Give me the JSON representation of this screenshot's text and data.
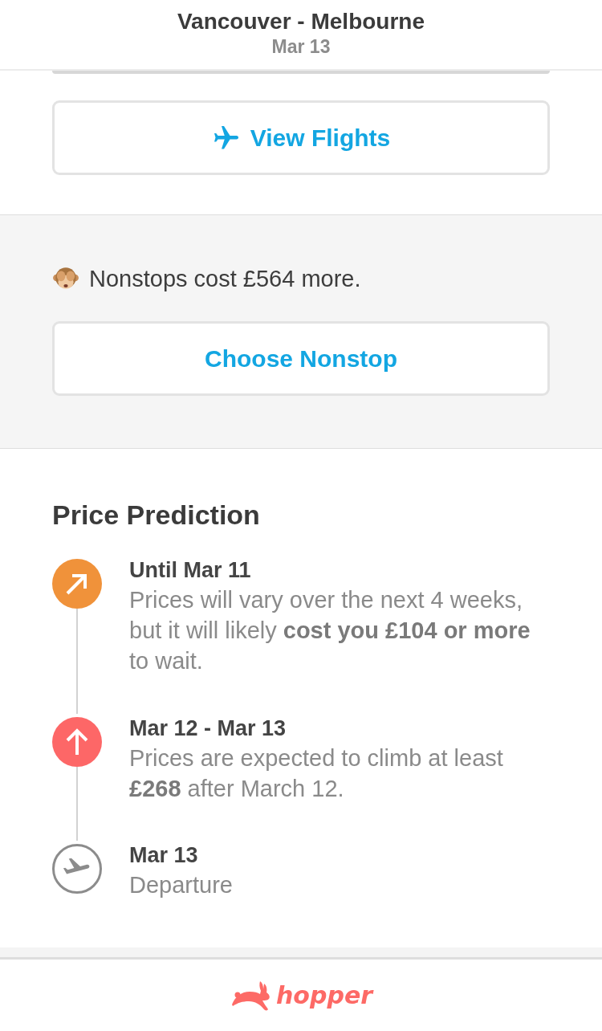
{
  "header": {
    "title": "Vancouver - Melbourne",
    "subtitle": "Mar 13"
  },
  "flights": {
    "button": "View Flights"
  },
  "nonstop": {
    "message": "Nonstops cost £564 more.",
    "button": "Choose Nonstop"
  },
  "price_prediction": {
    "title": "Price Prediction",
    "timeline": [
      {
        "kind": "diagonal-up",
        "color": "#f0923a",
        "title": "Until Mar 11",
        "text": "Prices will vary over the next 4 weeks, but it will likely **cost you £104 or more** to wait."
      },
      {
        "kind": "up",
        "color": "#fd6767",
        "title": "Mar 12 - Mar 13",
        "text": "Prices are expected to climb at least **£268** after March 12."
      },
      {
        "kind": "departure",
        "color": "#8c8c8c",
        "title": "Mar 13",
        "text": "Departure"
      }
    ]
  },
  "footer": {
    "logo_text": "hopper"
  }
}
